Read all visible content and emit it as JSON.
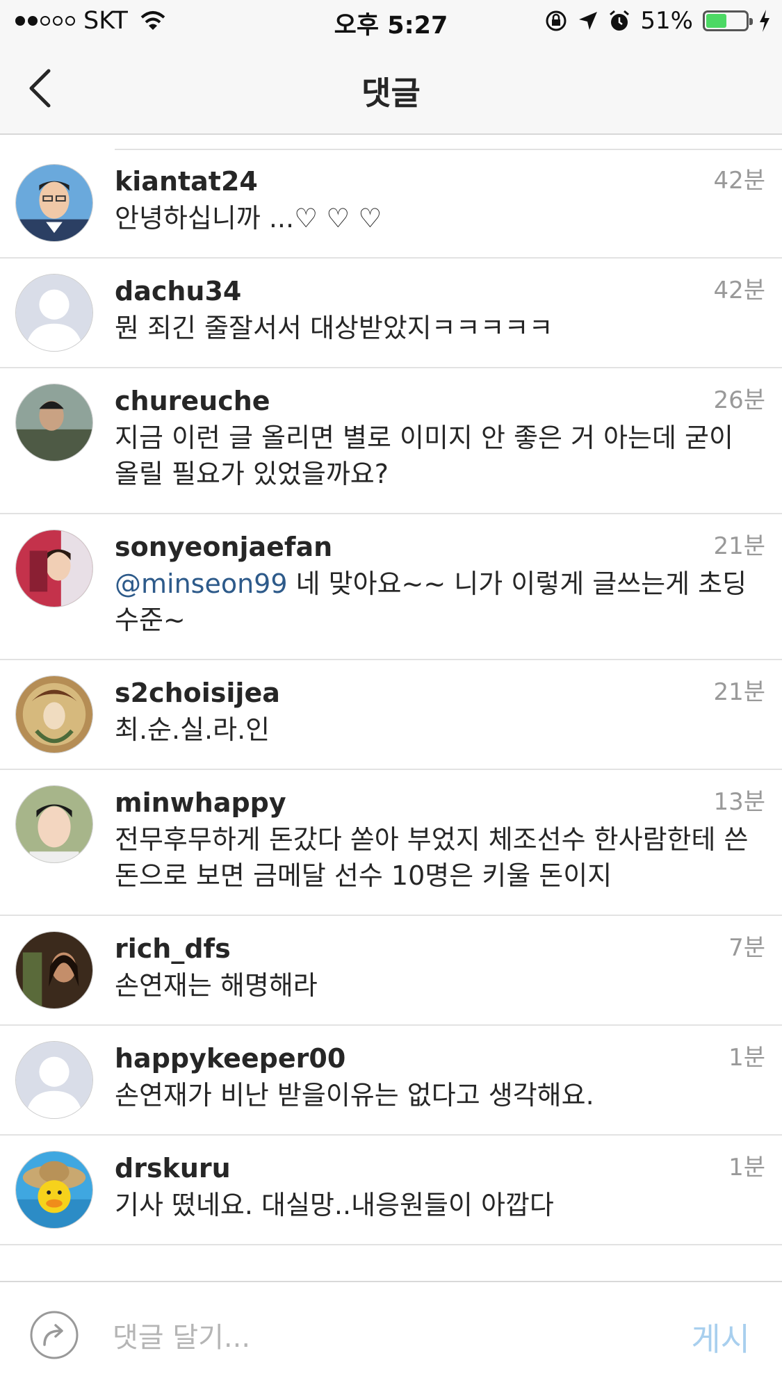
{
  "status_bar": {
    "carrier": "SKT",
    "time": "오후 5:27",
    "battery": "51%",
    "battery_level": 0.51
  },
  "nav": {
    "title": "댓글"
  },
  "comments": [
    {
      "user": "kiantat24",
      "time": "42분",
      "text": "안녕하십니까 ...♡ ♡ ♡",
      "avatar": "photo-man-glasses"
    },
    {
      "user": "dachu34",
      "time": "42분",
      "text": "뭔 죄긴 줄잘서서 대상받았지ㅋㅋㅋㅋㅋ",
      "avatar": "default-avatar"
    },
    {
      "user": "chureuche",
      "time": "26분",
      "text": "지금 이런 글 올리면 별로 이미지 안 좋은 거 아는데 굳이 올릴 필요가 있었을까요?",
      "avatar": "photo-person-green"
    },
    {
      "user": "sonyeonjaefan",
      "time": "21분",
      "mention": "@minseon99",
      "text": "네 맞아요~~ 니가 이렇게 글쓰는게 초딩 수준~",
      "avatar": "photo-gymnast"
    },
    {
      "user": "s2choisijea",
      "time": "21분",
      "text": "최.순.실.라.인",
      "avatar": "art-nouveau-portrait"
    },
    {
      "user": "minwhappy",
      "time": "13분",
      "text": "전무후무하게 돈갔다 쏟아 부었지 체조선수 한사람한테 쓴돈으로 보면 금메달 선수 10명은 키울 돈이지",
      "avatar": "photo-man-face"
    },
    {
      "user": "rich_dfs",
      "time": "7분",
      "text": "손연재는 해명해라",
      "avatar": "photo-movie-still"
    },
    {
      "user": "happykeeper00",
      "time": "1분",
      "text": "손연재가 비난 받을이유는 없다고 생각해요.",
      "avatar": "default-avatar"
    },
    {
      "user": "drskuru",
      "time": "1분",
      "text": "기사 떴네요. 대실망..내응원들이 아깝다",
      "avatar": "duck-straw-hat"
    }
  ],
  "compose": {
    "placeholder": "댓글 달기...",
    "post_label": "게시"
  },
  "colors": {
    "mention": "#2d5a8a",
    "post_disabled": "#a8cfee",
    "battery": "#4cd964"
  }
}
